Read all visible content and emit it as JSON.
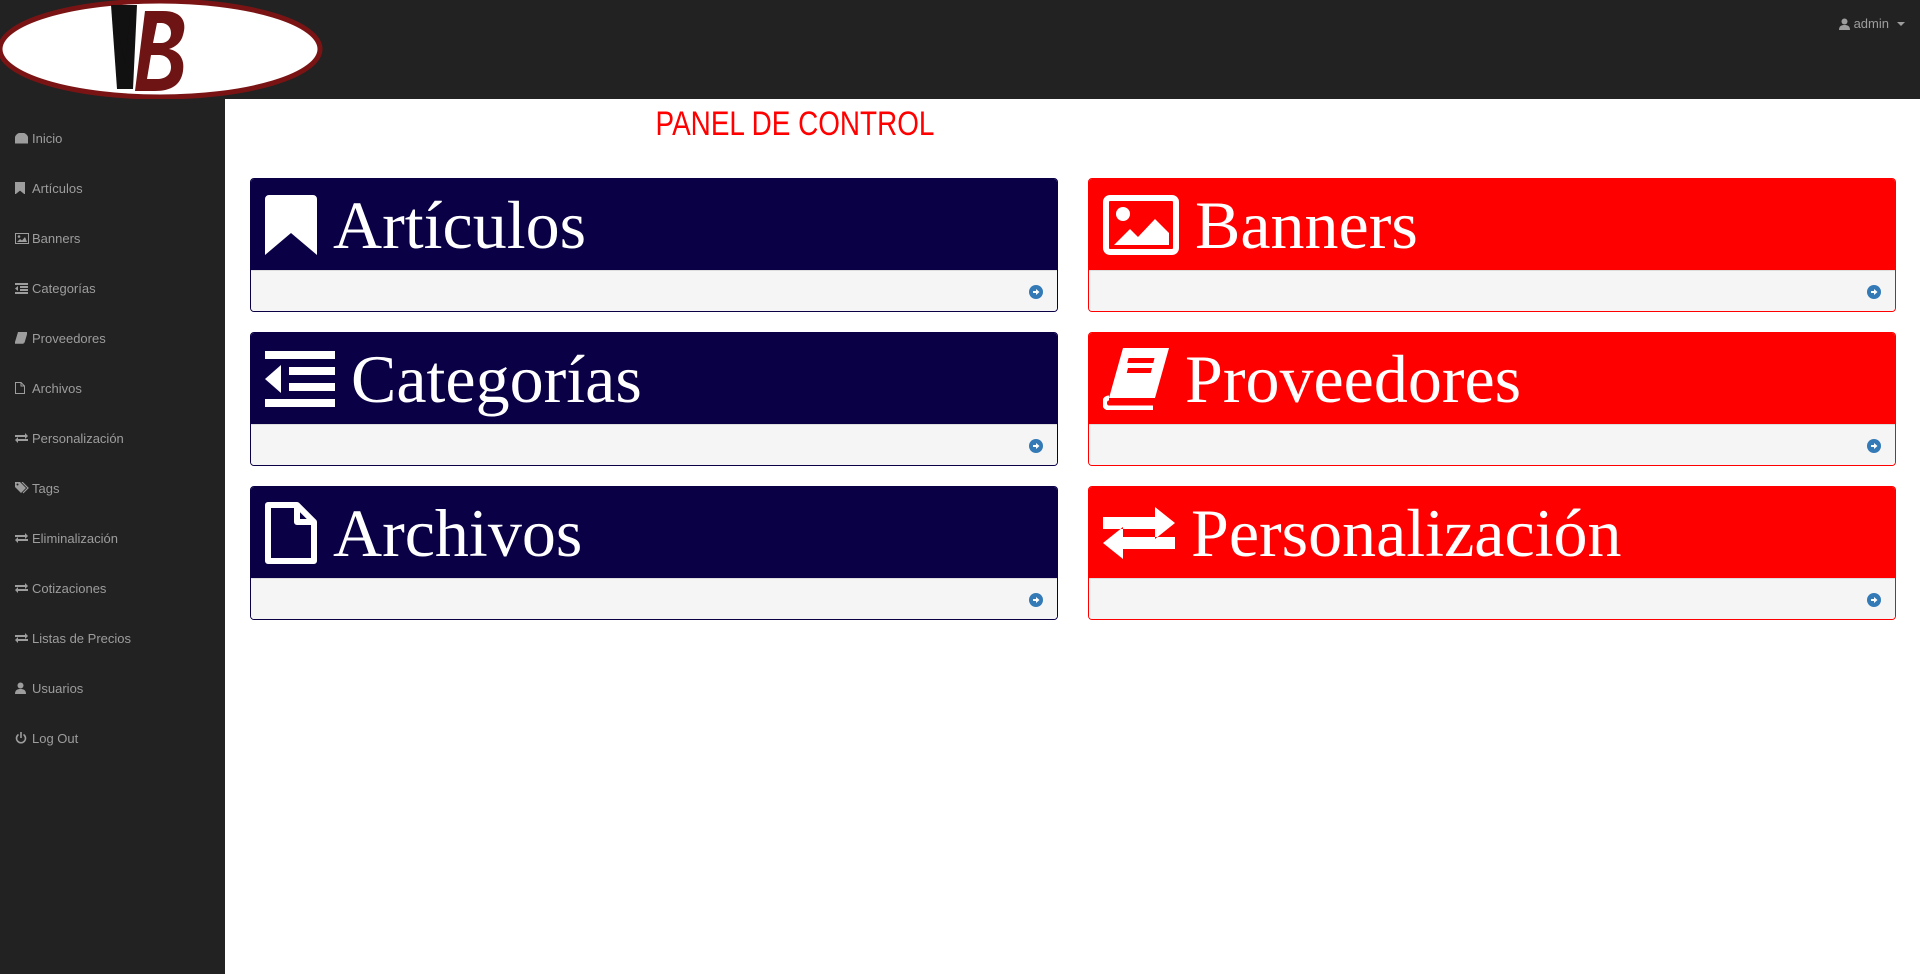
{
  "header": {
    "logo_text": "VB",
    "user_label": "admin"
  },
  "sidebar": {
    "items": [
      {
        "label": "Inicio",
        "icon": "dashboard-icon"
      },
      {
        "label": "Artículos",
        "icon": "bookmark-icon"
      },
      {
        "label": "Banners",
        "icon": "image-icon"
      },
      {
        "label": "Categorías",
        "icon": "list-indent-icon"
      },
      {
        "label": "Proveedores",
        "icon": "book-icon"
      },
      {
        "label": "Archivos",
        "icon": "file-icon"
      },
      {
        "label": "Personalización",
        "icon": "exchange-icon"
      },
      {
        "label": "Tags",
        "icon": "tags-icon"
      },
      {
        "label": "Eliminalización",
        "icon": "exchange-icon"
      },
      {
        "label": "Cotizaciones",
        "icon": "exchange-icon"
      },
      {
        "label": "Listas de Precios",
        "icon": "exchange-icon"
      },
      {
        "label": "Usuarios",
        "icon": "user-icon"
      },
      {
        "label": "Log Out",
        "icon": "power-icon"
      }
    ]
  },
  "main": {
    "title": "PANEL DE CONTROL",
    "panels": [
      {
        "label": "Artículos",
        "icon": "bookmark-icon",
        "color": "#0a0045"
      },
      {
        "label": "Banners",
        "icon": "image-icon",
        "color": "#ff0000"
      },
      {
        "label": "Categorías",
        "icon": "list-indent-icon",
        "color": "#0a0045"
      },
      {
        "label": "Proveedores",
        "icon": "book-icon",
        "color": "#ff0000"
      },
      {
        "label": "Archivos",
        "icon": "file-icon",
        "color": "#0a0045"
      },
      {
        "label": "Personalización",
        "icon": "exchange-icon",
        "color": "#ff0000"
      }
    ]
  },
  "colors": {
    "navbar": "#222222",
    "sidebar_text": "#9d9d9d",
    "title": "#ff0000",
    "panel_blue": "#0a0045",
    "panel_red": "#ff0000",
    "arrow": "#337ab7"
  }
}
